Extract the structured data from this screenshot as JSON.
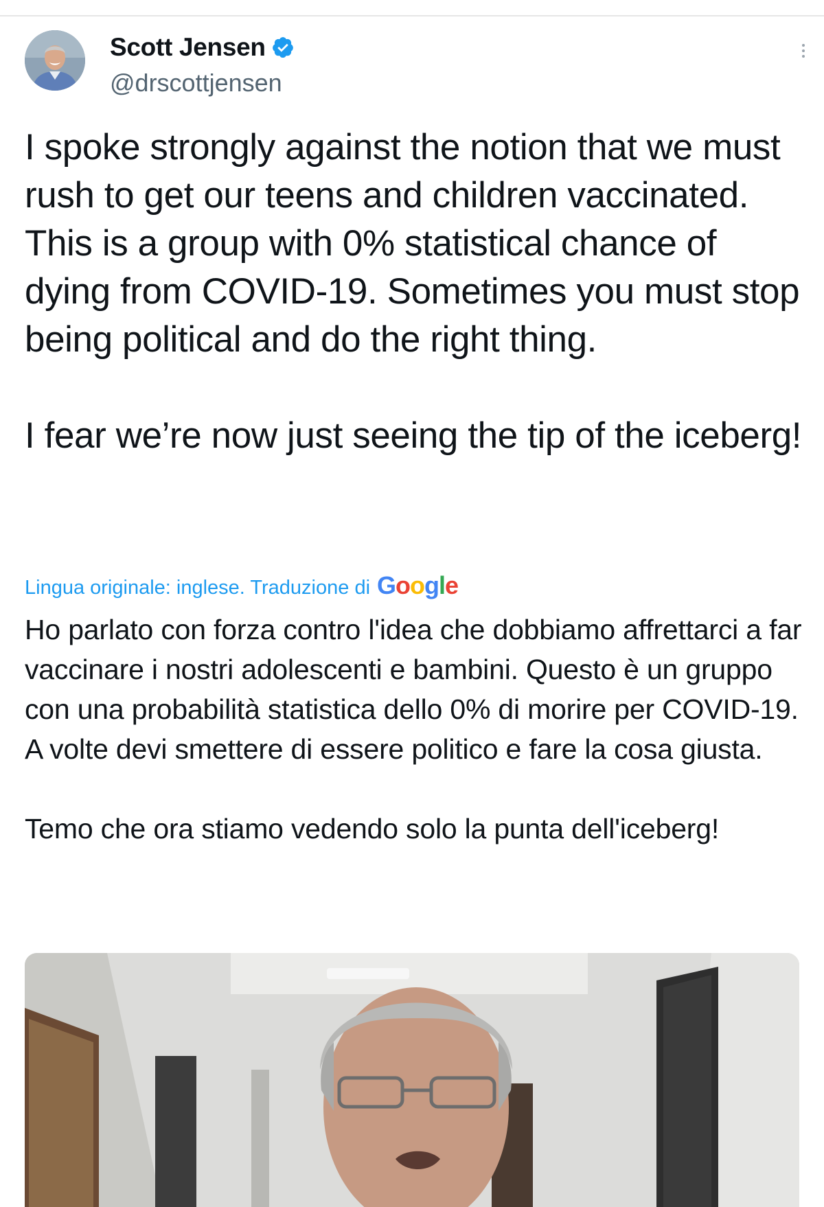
{
  "tweet": {
    "author": {
      "display_name": "Scott Jensen",
      "handle": "@drscottjensen",
      "verified": true,
      "avatar_icon": "profile-photo"
    },
    "more_icon": "more-vertical-icon",
    "text": "I spoke strongly against the notion that we must rush to get our teens and children vaccinated. This is a group with 0% statistical chance of dying from COVID-19. Sometimes you must stop being political and do the right thing.\n\nI fear we’re now just seeing the tip of the iceberg!",
    "translation": {
      "note": "Lingua originale: inglese. Traduzione di",
      "provider": "Google",
      "text": "Ho parlato con forza contro l'idea che dobbiamo affrettarci a far vaccinare i nostri adolescenti e bambini. Questo è un gruppo con una probabilità statistica dello 0% di morire per COVID-19. A volte devi smettere di essere politico e fare la cosa giusta.\n\n Temo che ora stiamo vedendo solo la punta dell'iceberg!"
    },
    "media": {
      "type": "video-thumbnail"
    }
  },
  "colors": {
    "link": "#1d9bf0",
    "verified": "#1d9bf0",
    "text": "#0f1419",
    "secondary": "#536471"
  }
}
